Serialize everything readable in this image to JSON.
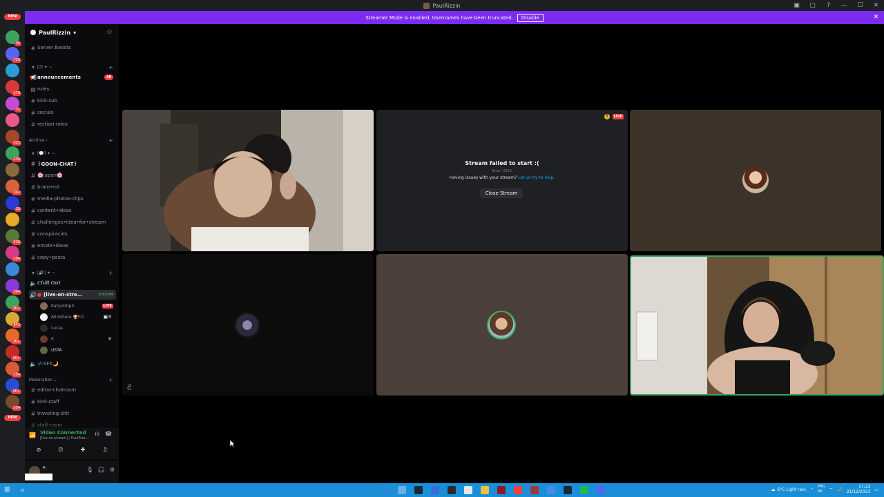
{
  "window": {
    "title": "PaulRizzin"
  },
  "banner": {
    "text": "Streamer Mode is enabled. Usernames have been truncated.",
    "disable_label": "Disable"
  },
  "rail": {
    "badges": [
      "30",
      "726",
      "170",
      "72",
      "323",
      "130",
      "342",
      "28",
      "436",
      "294",
      "394",
      "1K+",
      "843",
      "2K+",
      "1K+",
      "254",
      "1K+",
      "554"
    ],
    "new_label": "NEW"
  },
  "server": {
    "name": "PaulRizzin",
    "boosts": "Server Boosts"
  },
  "categories": {
    "cat1": "[?] ✦ ~",
    "archive": "Archive",
    "cat3": "[💬] ✦ ~",
    "cat4": "[🔊] ✦ ~",
    "moderation": "Moderation"
  },
  "channels": {
    "announcements": "announcements",
    "announcements_badge": "48",
    "rules": "rules",
    "kick_sub": "kick-sub",
    "socials": "socials",
    "rection_roles": "rection-roles",
    "goon_chat": "꒰GOON-CHAT꒱",
    "japan": "🌸japan🌸",
    "brain_rot": "brain•rot",
    "media_photos_clips": "media-photos-clips",
    "content_ideas": "content•ideas",
    "challenges": "challenges•idea•for•stream",
    "conspiracies": "conspiracies",
    "emote_ideas": "emote•ideas",
    "copy_pasta": "copy•pasta",
    "chill_out": "𝘾𝙝𝙞𝙡𝙡 𝙊𝙪𝙩",
    "live_on_stream": "[live-on-stre...",
    "live_timer": "3:43:04",
    "afk": "💤AFK🌙",
    "editor_chatroom": "editor-chatroom",
    "kick_staff": "kick-staff",
    "traveling": "traveling-shit",
    "staff_room": "staff-room"
  },
  "voice_users": [
    {
      "name": "KatyeD0p3",
      "live": "LIVE"
    },
    {
      "name": "Alinishere 🍄FO"
    },
    {
      "name": "Lucas"
    },
    {
      "name": "P..."
    },
    {
      "name": "USTA"
    }
  ],
  "voice_panel": {
    "status": "Video Connected",
    "sub": "[live-on-stream] / PaulRizz..."
  },
  "userbar": {
    "name": "P..."
  },
  "stream_error": {
    "title": "Stream failed to start :(",
    "code": "Error: 2012",
    "help": "Having issues with your stream?",
    "help_link": "Let us try to help.",
    "close_label": "Close Stream",
    "live_label": "LIVE"
  },
  "taskbar": {
    "weather": "6°C Light rain",
    "lang1": "ENG",
    "lang2": "UK",
    "time": "17:23",
    "date": "21/12/2023"
  },
  "colors": {
    "accent": "#7b2cf0",
    "green": "#3ba55d",
    "red": "#f23f43",
    "taskbar": "#1a8fd8"
  }
}
